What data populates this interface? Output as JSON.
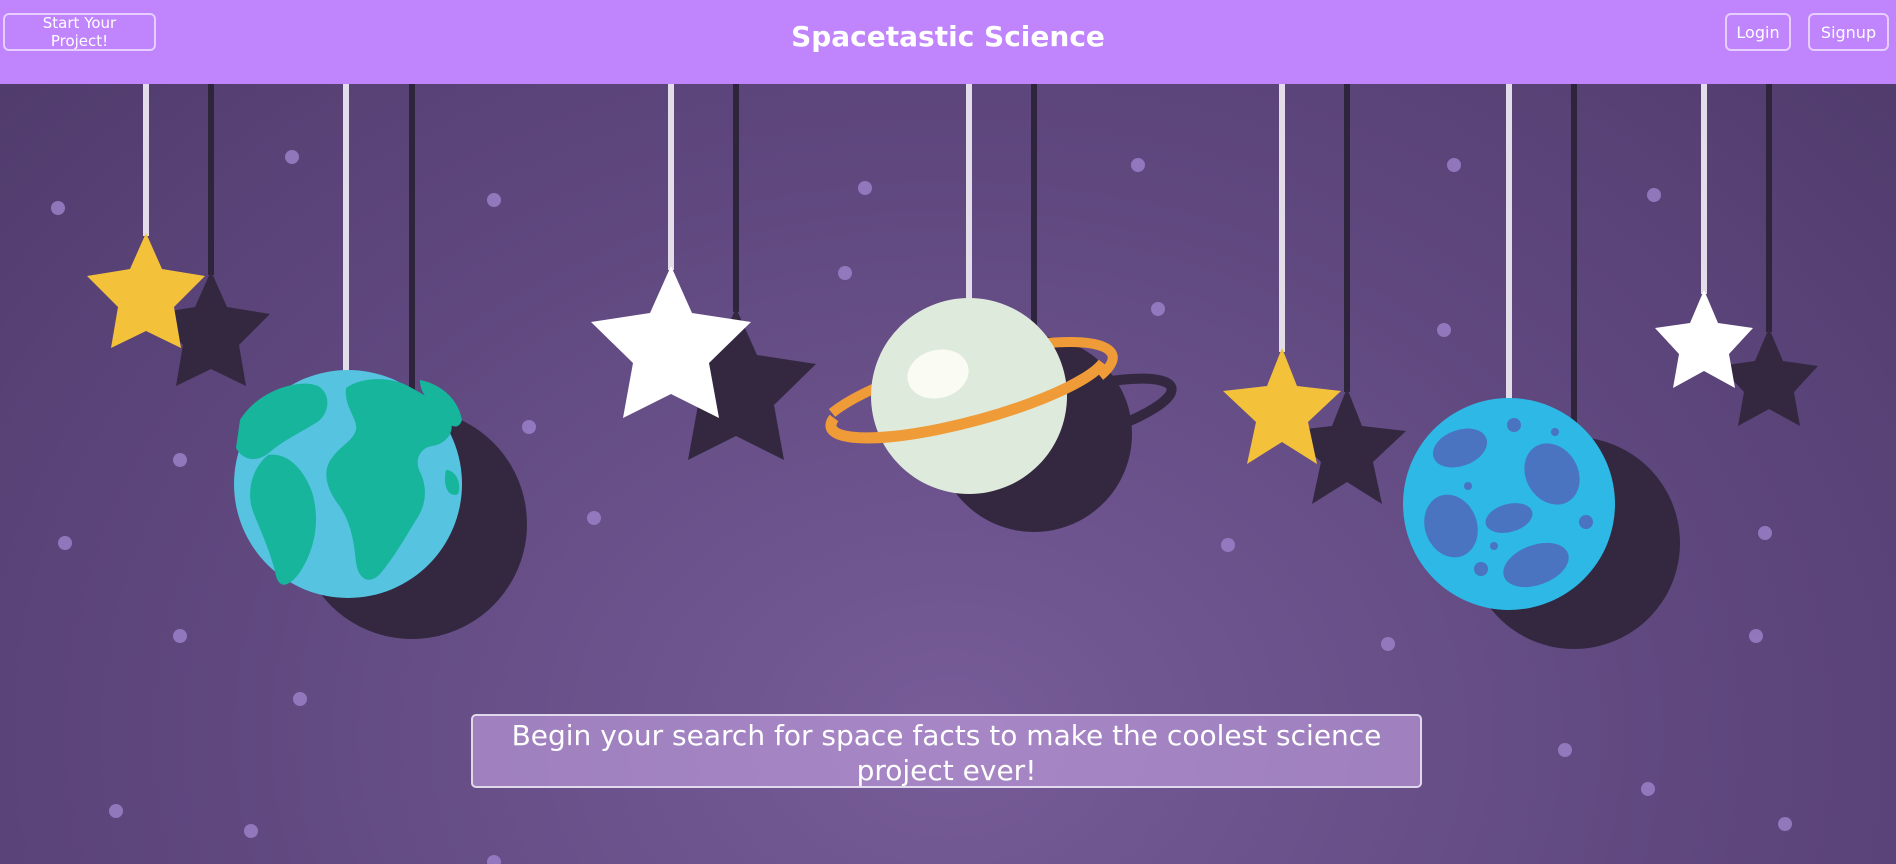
{
  "navbar": {
    "brand": "Spacetastic Science",
    "start_button": "Start Your Project!",
    "login_button": "Login",
    "signup_button": "Signup",
    "background_color": "#c084fc"
  },
  "hero": {
    "tagline": "Begin your search for space facts to make the coolest science project ever!",
    "decorations": [
      "yellow-star-icon",
      "earth-planet-icon",
      "white-star-icon",
      "ringed-planet-icon",
      "yellow-star-icon",
      "blue-cratered-planet-icon",
      "white-star-icon"
    ]
  },
  "colors": {
    "star_yellow": "#f4c23a",
    "star_white": "#ffffff",
    "shadow": "#332840",
    "earth_ocean": "#56c3e0",
    "earth_land": "#16b59c",
    "ring_planet": "#deeadb",
    "ring": "#ef9b38",
    "blue_planet": "#2db8e6",
    "craters": "#4a74bf"
  }
}
